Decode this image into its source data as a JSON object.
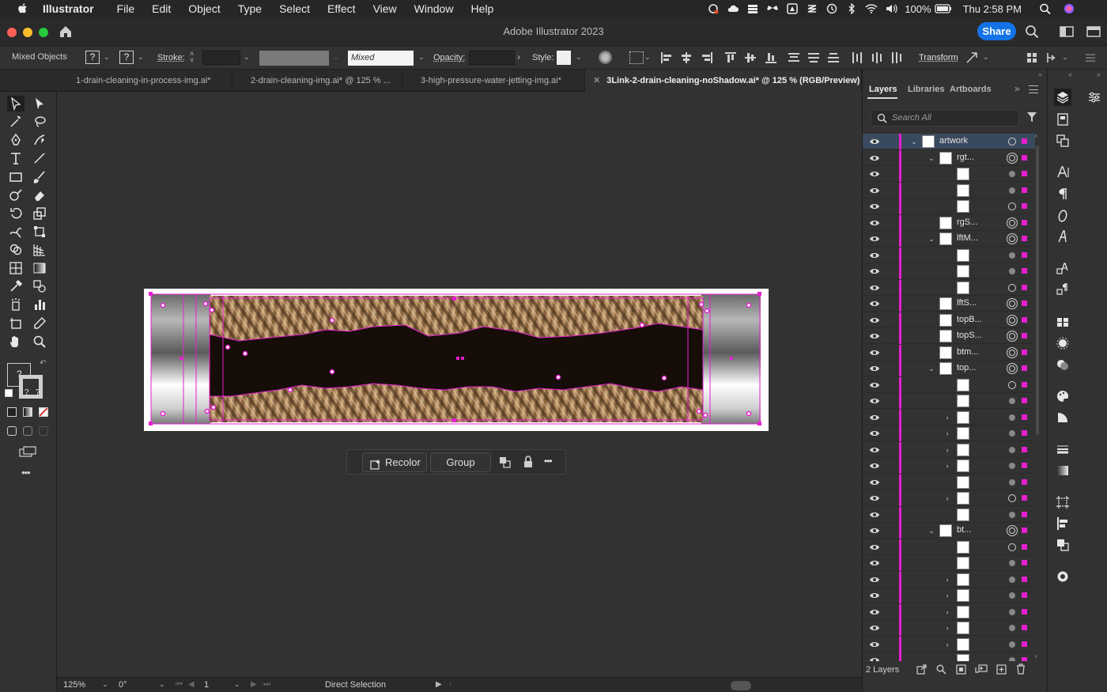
{
  "menubar": {
    "app_name": "Illustrator",
    "items": [
      "File",
      "Edit",
      "Object",
      "Type",
      "Select",
      "Effect",
      "View",
      "Window",
      "Help"
    ],
    "battery": "100%",
    "clock": "Thu 2:58 PM"
  },
  "titlebar": {
    "title": "Adobe Illustrator 2023",
    "share_label": "Share"
  },
  "controlbar": {
    "selection_type": "Mixed Objects",
    "fill_value": "?",
    "stroke_swatch_value": "?",
    "stroke_label": "Stroke:",
    "stroke_profile_value": "Mixed",
    "opacity_label": "Opacity:",
    "style_label": "Style:",
    "transform_label": "Transform"
  },
  "tabs": [
    {
      "label": "1-drain-cleaning-in-process-img.ai*",
      "active": false
    },
    {
      "label": "2-drain-cleaning-img.ai* @ 125 % ...",
      "active": false
    },
    {
      "label": "3-high-pressure-water-jetting-img.ai*",
      "active": false
    },
    {
      "label": "3Link-2-drain-cleaning-noShadow.ai* @ 125 % (RGB/Preview)",
      "active": true
    }
  ],
  "context_bar": {
    "recolor_label": "Recolor",
    "group_label": "Group",
    "more_label": "•••"
  },
  "statusbar": {
    "zoom": "125%",
    "rotation": "0°",
    "artboard_number": "1",
    "current_tool": "Direct Selection"
  },
  "layers_panel": {
    "tabs": [
      "Layers",
      "Libraries",
      "Artboards"
    ],
    "search_placeholder": "Search All",
    "layer_count": "2 Layers",
    "rows": [
      {
        "name": "artwork",
        "indent": 0,
        "twisty": "open",
        "target": "single"
      },
      {
        "name": "rgt...",
        "indent": 1,
        "twisty": "open",
        "target": "double"
      },
      {
        "name": "",
        "indent": 2,
        "twisty": "",
        "target": "dot"
      },
      {
        "name": "",
        "indent": 2,
        "twisty": "",
        "target": "dot"
      },
      {
        "name": "",
        "indent": 2,
        "twisty": "",
        "target": "single"
      },
      {
        "name": "rgS...",
        "indent": 1,
        "twisty": "",
        "target": "double"
      },
      {
        "name": "lftM...",
        "indent": 1,
        "twisty": "open",
        "target": "double"
      },
      {
        "name": "",
        "indent": 2,
        "twisty": "",
        "target": "dot"
      },
      {
        "name": "",
        "indent": 2,
        "twisty": "",
        "target": "dot"
      },
      {
        "name": "",
        "indent": 2,
        "twisty": "",
        "target": "single"
      },
      {
        "name": "lftS...",
        "indent": 1,
        "twisty": "",
        "target": "double"
      },
      {
        "name": "topB...",
        "indent": 1,
        "twisty": "",
        "target": "double"
      },
      {
        "name": "topS...",
        "indent": 1,
        "twisty": "",
        "target": "double"
      },
      {
        "name": "btm...",
        "indent": 1,
        "twisty": "",
        "target": "double"
      },
      {
        "name": "top...",
        "indent": 1,
        "twisty": "open",
        "target": "double"
      },
      {
        "name": "",
        "indent": 2,
        "twisty": "",
        "target": "single"
      },
      {
        "name": "",
        "indent": 2,
        "twisty": "",
        "target": "dot"
      },
      {
        "name": "",
        "indent": 2,
        "twisty": "closed",
        "target": "dot"
      },
      {
        "name": "",
        "indent": 2,
        "twisty": "closed",
        "target": "dot"
      },
      {
        "name": "",
        "indent": 2,
        "twisty": "closed",
        "target": "dot"
      },
      {
        "name": "",
        "indent": 2,
        "twisty": "closed",
        "target": "dot"
      },
      {
        "name": "",
        "indent": 2,
        "twisty": "",
        "target": "dot"
      },
      {
        "name": "",
        "indent": 2,
        "twisty": "closed",
        "target": "single"
      },
      {
        "name": "",
        "indent": 2,
        "twisty": "",
        "target": "dot"
      },
      {
        "name": "bt...",
        "indent": 1,
        "twisty": "open",
        "target": "double"
      },
      {
        "name": "",
        "indent": 2,
        "twisty": "",
        "target": "single"
      },
      {
        "name": "",
        "indent": 2,
        "twisty": "",
        "target": "dot"
      },
      {
        "name": "",
        "indent": 2,
        "twisty": "closed",
        "target": "dot"
      },
      {
        "name": "",
        "indent": 2,
        "twisty": "closed",
        "target": "dot"
      },
      {
        "name": "",
        "indent": 2,
        "twisty": "closed",
        "target": "dot"
      },
      {
        "name": "",
        "indent": 2,
        "twisty": "closed",
        "target": "dot"
      },
      {
        "name": "",
        "indent": 2,
        "twisty": "closed",
        "target": "dot"
      },
      {
        "name": "",
        "indent": 2,
        "twisty": "",
        "target": "dot"
      }
    ]
  },
  "colors": {
    "accent": "#1473e6",
    "selection": "#e51fd0",
    "layer_selected_bg": "#3a4a5e"
  }
}
